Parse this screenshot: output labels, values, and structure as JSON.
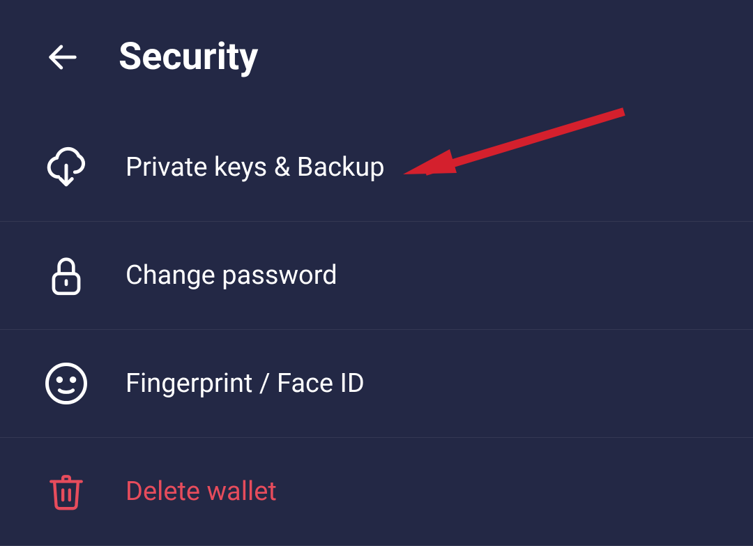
{
  "header": {
    "title": "Security"
  },
  "menu": {
    "items": [
      {
        "label": "Private keys & Backup"
      },
      {
        "label": "Change password"
      },
      {
        "label": "Fingerprint / Face ID"
      },
      {
        "label": "Delete wallet"
      }
    ]
  },
  "colors": {
    "background": "#232845",
    "text": "#ffffff",
    "danger": "#e74c5c",
    "annotation": "#d4202d"
  }
}
